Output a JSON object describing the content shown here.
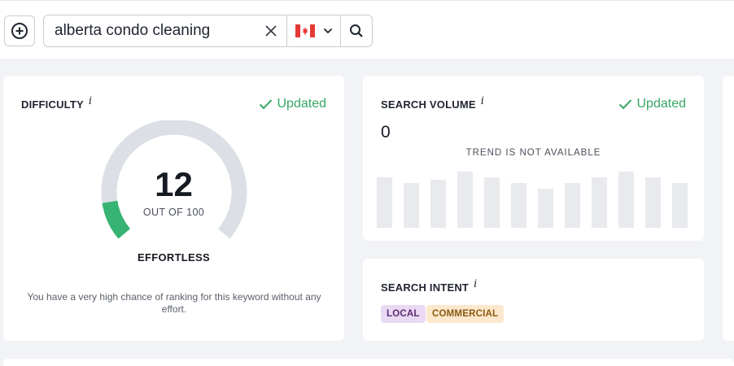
{
  "search": {
    "query": "alberta condo cleaning",
    "country_flag": "canada-flag-icon"
  },
  "difficulty": {
    "title": "DIFFICULTY",
    "info": "i",
    "status": "Updated",
    "value": "12",
    "score": 12,
    "max": 100,
    "out_of": "OUT OF 100",
    "level": "EFFORTLESS",
    "description": "You have a very high chance of ranking for this keyword without any effort."
  },
  "search_volume": {
    "title": "SEARCH VOLUME",
    "info": "i",
    "status": "Updated",
    "value": "0",
    "trend_message": "TREND IS NOT AVAILABLE"
  },
  "search_intent": {
    "title": "SEARCH INTENT",
    "info": "i",
    "badges": [
      "LOCAL",
      "COMMERCIAL"
    ]
  },
  "colors": {
    "updated_green": "#37a764",
    "gauge_track": "#dcdfe6",
    "gauge_fill": "#37b373",
    "placeholder_bar": "#e9eaee",
    "page_bg": "#f2f3f6"
  }
}
